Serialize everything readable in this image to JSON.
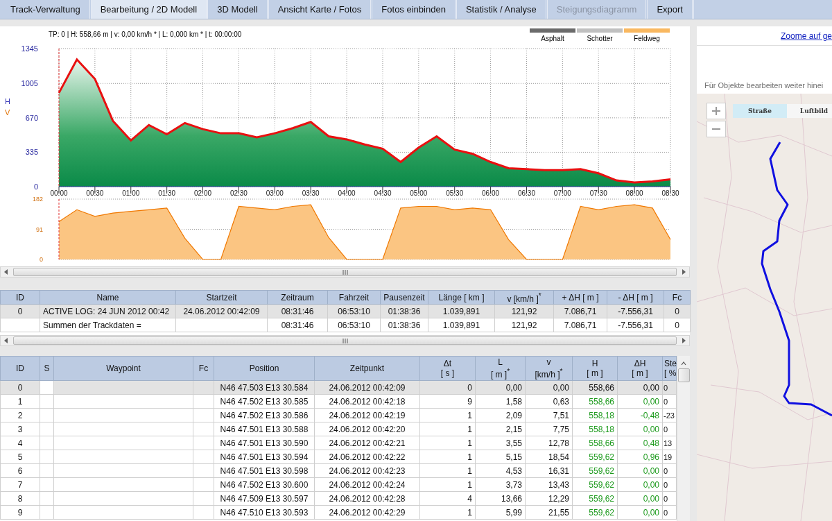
{
  "tabs": [
    {
      "label": "Track-Verwaltung",
      "selected": false,
      "disabled": false
    },
    {
      "label": "Bearbeitung / 2D Modell",
      "selected": true,
      "disabled": false
    },
    {
      "label": "3D Modell",
      "selected": false,
      "disabled": false
    },
    {
      "label": "Ansicht Karte / Fotos",
      "selected": false,
      "disabled": false
    },
    {
      "label": "Fotos einbinden",
      "selected": false,
      "disabled": false
    },
    {
      "label": "Statistik / Analyse",
      "selected": false,
      "disabled": false
    },
    {
      "label": "Steigungsdiagramm",
      "selected": false,
      "disabled": true
    },
    {
      "label": "Export",
      "selected": false,
      "disabled": false
    }
  ],
  "elevation_panel": {
    "info": "TP: 0 | H: 558,66 m | v: 0,00 km/h * | L: 0,000 km * | t: 00:00:00",
    "legend": [
      {
        "label": "Asphalt",
        "color": "#6b6b6b"
      },
      {
        "label": "Schotter",
        "color": "#c0c0c0"
      },
      {
        "label": "Feldweg",
        "color": "#f9b860"
      }
    ]
  },
  "elevation_chart": {
    "chart_data": {
      "type": "area",
      "grid": true,
      "ylim": [
        0,
        1345
      ],
      "xlim": [
        0,
        8.5
      ],
      "yticks": [
        0,
        335,
        670,
        1005,
        1345
      ],
      "xticks": [
        {
          "value": 0,
          "label": "00:00"
        },
        {
          "value": 0.5,
          "label": "00:30"
        },
        {
          "value": 1,
          "label": "01:00"
        },
        {
          "value": 1.5,
          "label": "01:30"
        },
        {
          "value": 2,
          "label": "02:00"
        },
        {
          "value": 2.5,
          "label": "02:30"
        },
        {
          "value": 3,
          "label": "03:00"
        },
        {
          "value": 3.5,
          "label": "03:30"
        },
        {
          "value": 4,
          "label": "04:00"
        },
        {
          "value": 4.5,
          "label": "04:30"
        },
        {
          "value": 5,
          "label": "05:00"
        },
        {
          "value": 5.5,
          "label": "05:30"
        },
        {
          "value": 6,
          "label": "06:00"
        },
        {
          "value": 6.5,
          "label": "06:30"
        },
        {
          "value": 7,
          "label": "07:00"
        },
        {
          "value": 7.5,
          "label": "07:30"
        },
        {
          "value": 8,
          "label": "08:00"
        },
        {
          "value": 8.5,
          "label": "08:30"
        }
      ],
      "x": [
        0,
        0.25,
        0.5,
        0.75,
        1,
        1.25,
        1.5,
        1.75,
        2,
        2.25,
        2.5,
        2.75,
        3,
        3.25,
        3.5,
        3.75,
        4,
        4.25,
        4.5,
        4.75,
        5,
        5.25,
        5.5,
        5.75,
        6,
        6.25,
        6.5,
        6.75,
        7,
        7.25,
        7.5,
        7.75,
        8,
        8.25,
        8.5
      ],
      "series": [
        {
          "name": "H",
          "color": "#e81010",
          "values": [
            913,
            1239,
            1049,
            641,
            450,
            600,
            510,
            620,
            560,
            520,
            520,
            480,
            520,
            570,
            630,
            490,
            460,
            410,
            370,
            240,
            380,
            490,
            360,
            320,
            240,
            180,
            170,
            160,
            160,
            170,
            130,
            60,
            40,
            50,
            70
          ]
        }
      ]
    }
  },
  "speed_chart": {
    "chart_data": {
      "type": "area",
      "grid": true,
      "ylim": [
        0,
        182
      ],
      "xlim": [
        0,
        8.5
      ],
      "yticks": [
        0,
        91,
        182
      ],
      "x": [
        0,
        0.25,
        0.5,
        0.75,
        1,
        1.25,
        1.5,
        1.75,
        2,
        2.25,
        2.5,
        2.75,
        3,
        3.25,
        3.5,
        3.75,
        4,
        4.25,
        4.5,
        4.75,
        5,
        5.25,
        5.5,
        5.75,
        6,
        6.25,
        6.5,
        6.75,
        7,
        7.25,
        7.5,
        7.75,
        8,
        8.25,
        8.5
      ],
      "series": [
        {
          "name": "V",
          "color": "#fbc582",
          "values": [
            114,
            150,
            130,
            140,
            145,
            150,
            155,
            64,
            0,
            0,
            160,
            155,
            150,
            160,
            165,
            66,
            0,
            0,
            0,
            155,
            160,
            160,
            150,
            155,
            150,
            60,
            0,
            0,
            0,
            160,
            150,
            160,
            165,
            155,
            60
          ]
        }
      ]
    }
  },
  "track_table": {
    "columns": [
      "ID",
      "Name",
      "Startzeit",
      "Zeitraum",
      "Fahrzeit",
      "Pausenzeit",
      "Länge  [ km ]",
      "v  [km/h ]$^{*}$",
      "+ ΔH  [ m ]",
      "- ΔH  [ m ]",
      "Fc"
    ],
    "rows": [
      {
        "selected": true,
        "cells": [
          "0",
          "ACTIVE LOG: 24 JUN 2012 00:42",
          "24.06.2012 00:42:09",
          "08:31:46",
          "06:53:10",
          "01:38:36",
          "1.039,891",
          "121,92",
          "7.086,71",
          "-7.556,31",
          "0"
        ]
      },
      {
        "selected": false,
        "cells": [
          null,
          "Summen der Trackdaten =",
          null,
          "08:31:46",
          "06:53:10",
          "01:38:36",
          "1.039,891",
          "121,92",
          "7.086,71",
          "-7.556,31",
          "0"
        ]
      }
    ]
  },
  "waypoint_table": {
    "columns": [
      "ID",
      "S",
      "Waypoint",
      "Fc",
      "Position",
      "Zeitpunkt",
      "Δt\n[ s ]",
      "L\n[ m ]$^{*}$",
      "v\n[km/h ]$^{*}$",
      "H\n[ m ]",
      "ΔH\n[ m ]",
      "Ste\n[ %"
    ],
    "rows": [
      {
        "selected": true,
        "cells": [
          "0",
          null,
          null,
          null,
          "N46 47.503 E13 30.584",
          "24.06.2012 00:42:09",
          "0",
          "0,00",
          "0,00",
          "558,66",
          "0,00",
          "0"
        ]
      },
      {
        "selected": false,
        "cells": [
          "1",
          null,
          null,
          null,
          "N46 47.502 E13 30.585",
          "24.06.2012 00:42:18",
          "9",
          "1,58",
          "0,63",
          "558,66",
          "0,00",
          "0"
        ]
      },
      {
        "selected": false,
        "cells": [
          "2",
          null,
          null,
          null,
          "N46 47.502 E13 30.586",
          "24.06.2012 00:42:19",
          "1",
          "2,09",
          "7,51",
          "558,18",
          "-0,48",
          "-23"
        ]
      },
      {
        "selected": false,
        "cells": [
          "3",
          null,
          null,
          null,
          "N46 47.501 E13 30.588",
          "24.06.2012 00:42:20",
          "1",
          "2,15",
          "7,75",
          "558,18",
          "0,00",
          "0"
        ]
      },
      {
        "selected": false,
        "cells": [
          "4",
          null,
          null,
          null,
          "N46 47.501 E13 30.590",
          "24.06.2012 00:42:21",
          "1",
          "3,55",
          "12,78",
          "558,66",
          "0,48",
          "13"
        ]
      },
      {
        "selected": false,
        "cells": [
          "5",
          null,
          null,
          null,
          "N46 47.501 E13 30.594",
          "24.06.2012 00:42:22",
          "1",
          "5,15",
          "18,54",
          "559,62",
          "0,96",
          "19"
        ]
      },
      {
        "selected": false,
        "cells": [
          "6",
          null,
          null,
          null,
          "N46 47.501 E13 30.598",
          "24.06.2012 00:42:23",
          "1",
          "4,53",
          "16,31",
          "559,62",
          "0,00",
          "0"
        ]
      },
      {
        "selected": false,
        "cells": [
          "7",
          null,
          null,
          null,
          "N46 47.502 E13 30.600",
          "24.06.2012 00:42:24",
          "1",
          "3,73",
          "13,43",
          "559,62",
          "0,00",
          "0"
        ]
      },
      {
        "selected": false,
        "cells": [
          "8",
          null,
          null,
          null,
          "N46 47.509 E13 30.597",
          "24.06.2012 00:42:28",
          "4",
          "13,66",
          "12,29",
          "559,62",
          "0,00",
          "0"
        ]
      },
      {
        "selected": false,
        "cells": [
          "9",
          null,
          null,
          null,
          "N46 47.510 E13 30.593",
          "24.06.2012 00:42:29",
          "1",
          "5,99",
          "21,55",
          "559,62",
          "0,00",
          "0"
        ]
      }
    ]
  },
  "map_panel": {
    "zoom_link": "Zoome auf ge",
    "hint": "Für Objekte bearbeiten weiter hinei",
    "map_types": [
      {
        "label": "Straße",
        "selected": true
      },
      {
        "label": "Luftbild",
        "selected": false
      }
    ]
  }
}
